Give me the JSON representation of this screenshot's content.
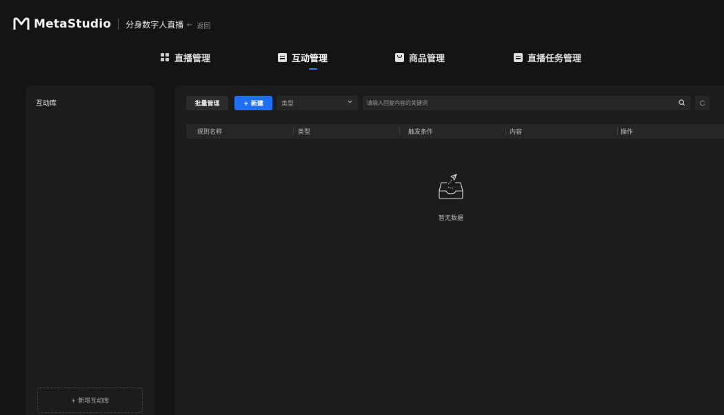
{
  "header": {
    "brand": "MetaStudio",
    "product": "分身数字人直播",
    "back_label": "返回"
  },
  "nav": {
    "tabs": [
      {
        "label": "直播管理",
        "icon": "grid-icon"
      },
      {
        "label": "互动管理",
        "icon": "doc-icon",
        "active": true
      },
      {
        "label": "商品管理",
        "icon": "shop-icon"
      },
      {
        "label": "直播任务管理",
        "icon": "doc-icon"
      }
    ]
  },
  "sidebar": {
    "title": "互动库",
    "add_label": "+ 新增互动库"
  },
  "toolbar": {
    "batch_label": "批量管理",
    "new_label": "+ 新建",
    "type_select_value": "类型",
    "search_placeholder": "请输入回复内容的关键词"
  },
  "table": {
    "columns": [
      "规则名称",
      "类型",
      "触发条件",
      "内容",
      "操作"
    ]
  },
  "empty": {
    "text": "暂无数据"
  },
  "colors": {
    "accent": "#1f6fff",
    "background": "#141414",
    "panel": "#1c1c1c"
  }
}
